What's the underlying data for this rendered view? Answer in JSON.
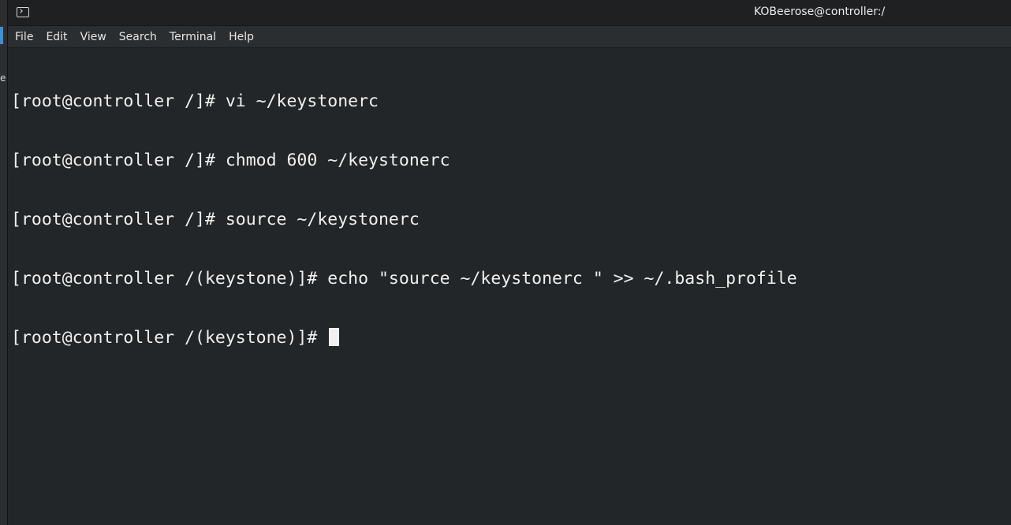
{
  "window": {
    "title": "KOBeerose@controller:/"
  },
  "menu": [
    {
      "label": "File"
    },
    {
      "label": "Edit"
    },
    {
      "label": "View"
    },
    {
      "label": "Search"
    },
    {
      "label": "Terminal"
    },
    {
      "label": "Help"
    }
  ],
  "terminal": {
    "lines": [
      "[root@controller /]# vi ~/keystonerc",
      "[root@controller /]# chmod 600 ~/keystonerc",
      "[root@controller /]# source ~/keystonerc",
      "[root@controller /(keystone)]# echo \"source ~/keystonerc \" >> ~/.bash_profile"
    ],
    "prompt": "[root@controller /(keystone)]# "
  },
  "sidebar_fragment": {
    "glyph": "e"
  },
  "colors": {
    "titlebar": "#1e2022",
    "menubar": "#2b2e30",
    "terminal_bg": "#232628",
    "terminal_fg": "#f0f0f0"
  }
}
